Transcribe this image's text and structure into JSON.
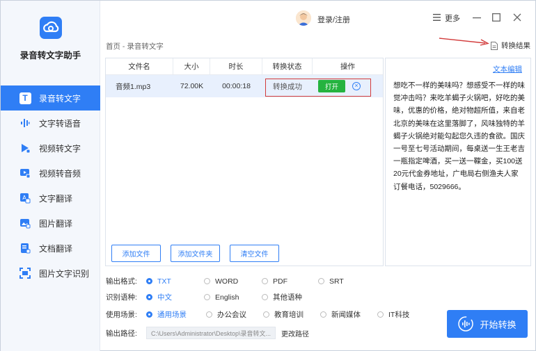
{
  "app": {
    "name": "录音转文字助手"
  },
  "topbar": {
    "login": "登录/注册",
    "more": "更多"
  },
  "sidebar": {
    "items": [
      {
        "label": "录音转文字",
        "icon": "T",
        "active": true
      },
      {
        "label": "文字转语音",
        "icon": "audio-wave"
      },
      {
        "label": "视频转文字",
        "icon": "play"
      },
      {
        "label": "视频转音频",
        "icon": "video"
      },
      {
        "label": "文字翻译",
        "icon": "translate"
      },
      {
        "label": "图片翻译",
        "icon": "image"
      },
      {
        "label": "文档翻译",
        "icon": "doc"
      },
      {
        "label": "图片文字识别",
        "icon": "scan"
      }
    ]
  },
  "breadcrumb": "首页 - 录音转文字",
  "result_link": "转换结果",
  "table": {
    "headers": [
      "文件名",
      "大小",
      "时长",
      "转换状态",
      "操作"
    ],
    "rows": [
      {
        "name": "音频1.mp3",
        "size": "72.00K",
        "duration": "00:00:18",
        "status": "转换成功",
        "action": "打开"
      }
    ]
  },
  "panel_buttons": {
    "add_file": "添加文件",
    "add_folder": "添加文件夹",
    "clear": "清空文件"
  },
  "text_panel": {
    "edit": "文本编辑",
    "content": "想吃不一样的美味吗？想感受不一样的味觉冲击吗？来吃羊蝎子火锅吧，好吃的美味，优惠的价格，绝对物超所值，来自老北京的美味在这里落脚了，风味独特的羊蝎子火锅绝对能勾起您久违的食欲。国庆一号至七号活动期间，每桌送一生王老吉一瓶指定啤酒，买一送一鞢金，买100送20元代金券地址，广电局右侧渔夫人家订餐电话，5029666。"
  },
  "options": {
    "format_label": "输出格式:",
    "formats": [
      "TXT",
      "WORD",
      "PDF",
      "SRT"
    ],
    "lang_label": "识别语种:",
    "langs": [
      "中文",
      "English",
      "其他语种"
    ],
    "scene_label": "使用场景:",
    "scenes": [
      "通用场景",
      "办公会议",
      "教育培训",
      "新闻媒体",
      "IT科技"
    ],
    "path_label": "输出路径:",
    "path_value": "C:\\Users\\Administrator\\Desktop\\录音转文...",
    "change_path": "更改路径"
  },
  "start_button": "开始转换",
  "colors": {
    "accent": "#2f7ef5",
    "success": "#25b33f",
    "highlight": "#d23a3a"
  }
}
